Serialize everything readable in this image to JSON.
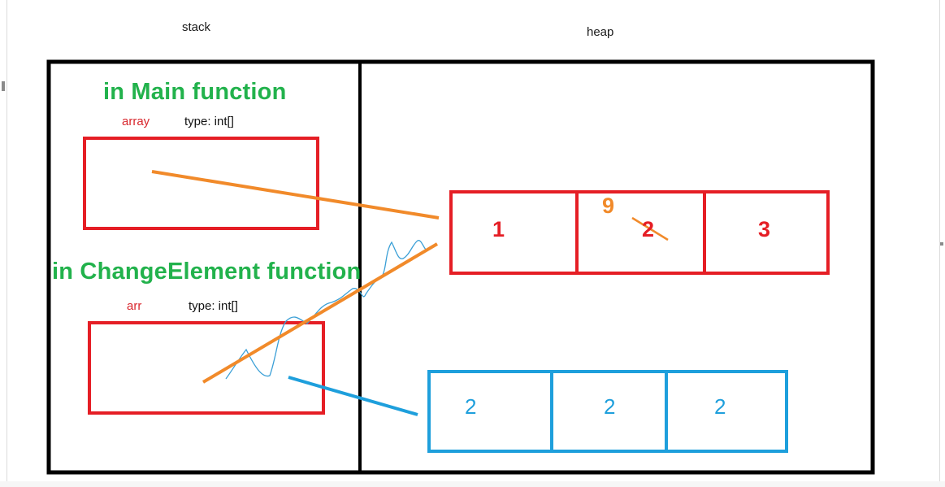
{
  "regions": {
    "stack": "stack",
    "heap": "heap"
  },
  "main_frame": {
    "heading": "in Main function",
    "var_name": "array",
    "var_type": "type: int[]"
  },
  "change_frame": {
    "heading": "in ChangeElement function",
    "var_name": "arr",
    "var_type": "type: int[]"
  },
  "heap_array_original": {
    "cells": [
      "1",
      "2",
      "3"
    ],
    "overwritten_with": "9"
  },
  "heap_array_new": {
    "cells": [
      "2",
      "2",
      "2"
    ]
  },
  "colors": {
    "frame": "#000000",
    "stack_box": "#e51e25",
    "reference_arrow": "#f18a2a",
    "new_array": "#1e9fdc",
    "heading": "#22b24c",
    "scribble": "#3a9fd6"
  }
}
